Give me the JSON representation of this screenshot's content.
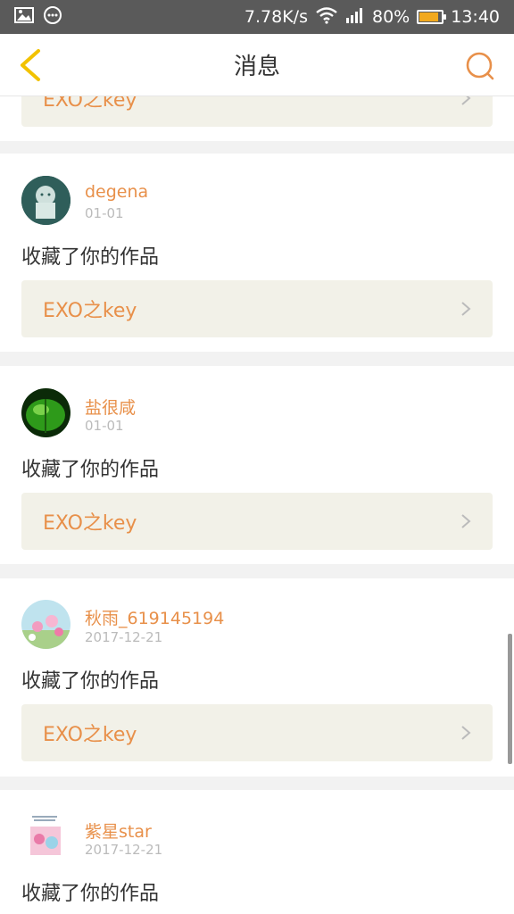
{
  "status_bar": {
    "speed": "7.78K/s",
    "battery": "80%",
    "battery_level": 0.8,
    "time": "13:40"
  },
  "header": {
    "title": "消息",
    "back_icon": "chevron-left-icon",
    "search_icon": "search-icon"
  },
  "colors": {
    "accent": "#e8904a",
    "back_arrow": "#f2c200",
    "work_bg": "#f2f1e8"
  },
  "messages": [
    {
      "username": "",
      "date": "",
      "action": "",
      "work_title": "EXO之key"
    },
    {
      "username": "degena",
      "date": "01-01",
      "action": "收藏了你的作品",
      "work_title": "EXO之key"
    },
    {
      "username": "盐很咸",
      "date": "01-01",
      "action": "收藏了你的作品",
      "work_title": "EXO之key"
    },
    {
      "username": "秋雨_619145194",
      "date": "2017-12-21",
      "action": "收藏了你的作品",
      "work_title": "EXO之key"
    },
    {
      "username": "紫星star",
      "date": "2017-12-21",
      "action": "收藏了你的作品",
      "work_title": ""
    }
  ]
}
